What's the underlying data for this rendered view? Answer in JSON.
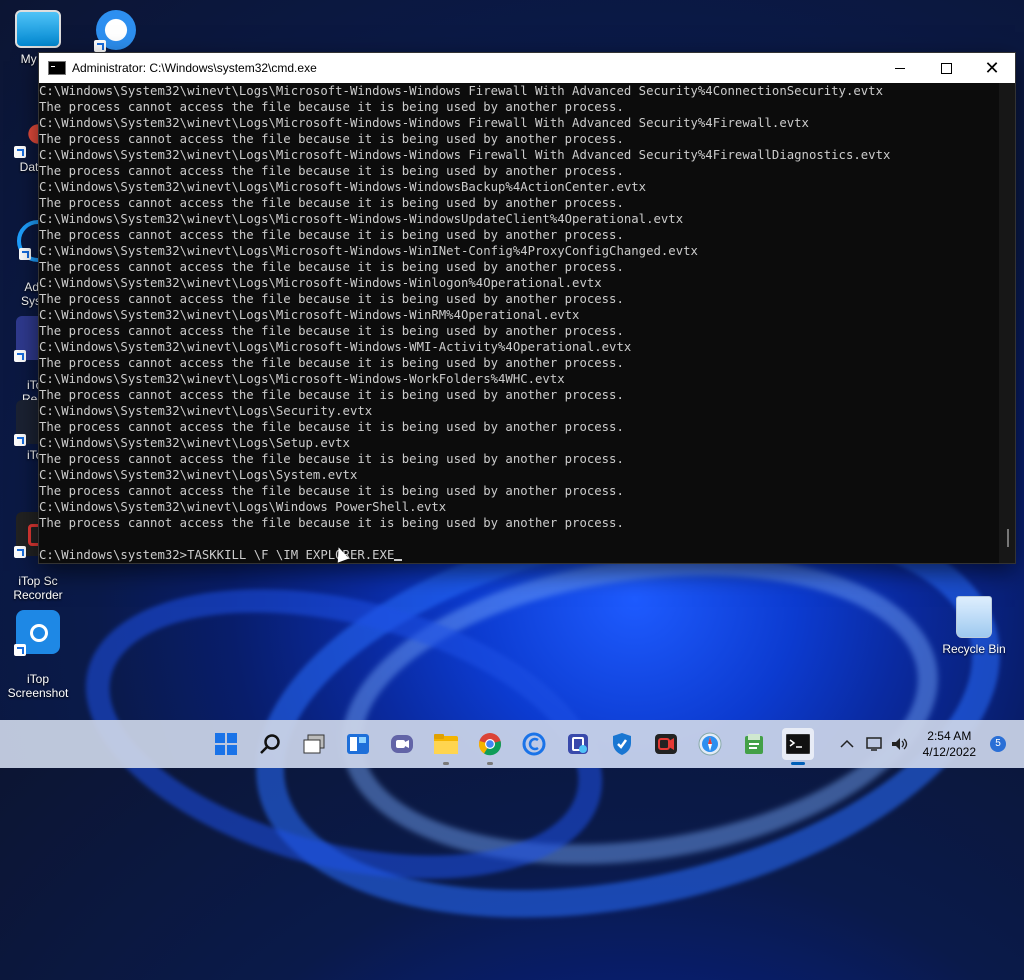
{
  "desktop": {
    "icons": [
      {
        "label": "My Co"
      },
      {
        "label": ""
      },
      {
        "label": "DataW"
      },
      {
        "label": "Adva\nSyster"
      },
      {
        "label": "iTop\nRecor"
      },
      {
        "label": "iTop"
      },
      {
        "label": "iTop Sc\nRecorder"
      },
      {
        "label": "iTop\nScreenshot"
      },
      {
        "label": "Recycle Bin"
      }
    ]
  },
  "window": {
    "title": "Administrator: C:\\Windows\\system32\\cmd.exe",
    "close_glyph": "✕"
  },
  "console": {
    "lines": [
      "C:\\Windows\\System32\\winevt\\Logs\\Microsoft-Windows-Windows Firewall With Advanced Security%4ConnectionSecurity.evtx",
      "The process cannot access the file because it is being used by another process.",
      "C:\\Windows\\System32\\winevt\\Logs\\Microsoft-Windows-Windows Firewall With Advanced Security%4Firewall.evtx",
      "The process cannot access the file because it is being used by another process.",
      "C:\\Windows\\System32\\winevt\\Logs\\Microsoft-Windows-Windows Firewall With Advanced Security%4FirewallDiagnostics.evtx",
      "The process cannot access the file because it is being used by another process.",
      "C:\\Windows\\System32\\winevt\\Logs\\Microsoft-Windows-WindowsBackup%4ActionCenter.evtx",
      "The process cannot access the file because it is being used by another process.",
      "C:\\Windows\\System32\\winevt\\Logs\\Microsoft-Windows-WindowsUpdateClient%4Operational.evtx",
      "The process cannot access the file because it is being used by another process.",
      "C:\\Windows\\System32\\winevt\\Logs\\Microsoft-Windows-WinINet-Config%4ProxyConfigChanged.evtx",
      "The process cannot access the file because it is being used by another process.",
      "C:\\Windows\\System32\\winevt\\Logs\\Microsoft-Windows-Winlogon%4Operational.evtx",
      "The process cannot access the file because it is being used by another process.",
      "C:\\Windows\\System32\\winevt\\Logs\\Microsoft-Windows-WinRM%4Operational.evtx",
      "The process cannot access the file because it is being used by another process.",
      "C:\\Windows\\System32\\winevt\\Logs\\Microsoft-Windows-WMI-Activity%4Operational.evtx",
      "The process cannot access the file because it is being used by another process.",
      "C:\\Windows\\System32\\winevt\\Logs\\Microsoft-Windows-WorkFolders%4WHC.evtx",
      "The process cannot access the file because it is being used by another process.",
      "C:\\Windows\\System32\\winevt\\Logs\\Security.evtx",
      "The process cannot access the file because it is being used by another process.",
      "C:\\Windows\\System32\\winevt\\Logs\\Setup.evtx",
      "The process cannot access the file because it is being used by another process.",
      "C:\\Windows\\System32\\winevt\\Logs\\System.evtx",
      "The process cannot access the file because it is being used by another process.",
      "C:\\Windows\\System32\\winevt\\Logs\\Windows PowerShell.evtx",
      "The process cannot access the file because it is being used by another process.",
      ""
    ],
    "prompt_line": "C:\\Windows\\system32>TASKKILL \\F \\IM EXPLORER.EXE"
  },
  "taskbar": {
    "icons": [
      {
        "name": "start-icon"
      },
      {
        "name": "search-icon"
      },
      {
        "name": "task-view-icon"
      },
      {
        "name": "widgets-icon"
      },
      {
        "name": "chat-icon"
      },
      {
        "name": "file-explorer-icon"
      },
      {
        "name": "chrome-icon"
      },
      {
        "name": "advanced-systemcare-icon"
      },
      {
        "name": "itop-screen-recorder-icon"
      },
      {
        "name": "security-shield-icon"
      },
      {
        "name": "itop-recorder-icon"
      },
      {
        "name": "safari-browser-icon"
      },
      {
        "name": "notepad-icon"
      },
      {
        "name": "cmd-icon"
      }
    ],
    "clock": {
      "time": "2:54 AM",
      "date": "4/12/2022"
    },
    "notification_count": "5",
    "colors": {
      "accent": "#005fb8",
      "console_bg": "#0c0c0c",
      "console_fg": "#cccccc"
    }
  }
}
